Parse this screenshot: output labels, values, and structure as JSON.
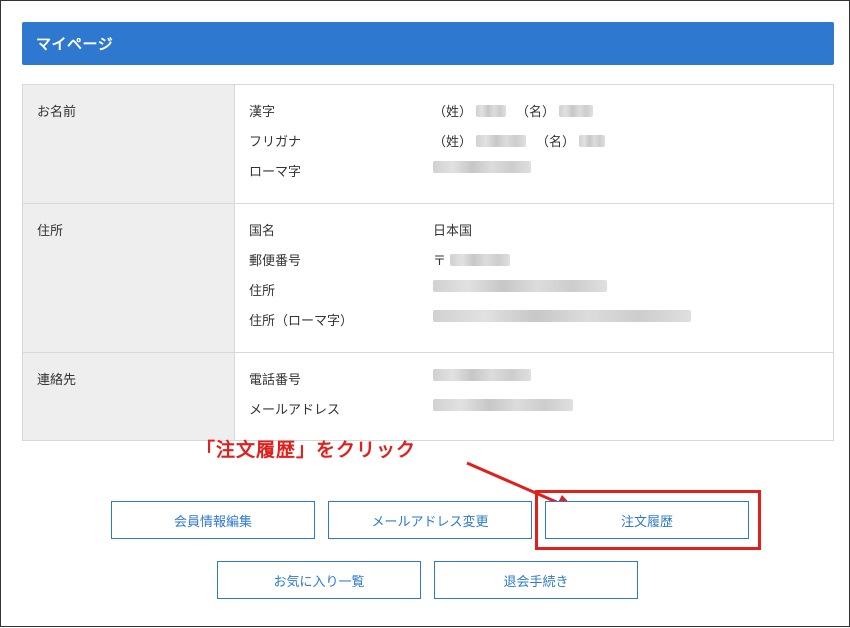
{
  "header": {
    "title": "マイページ"
  },
  "sections": {
    "name": {
      "label": "お名前",
      "fields": {
        "kanji": {
          "label": "漢字",
          "sei": "（姓）",
          "mei": "（名）"
        },
        "furigana": {
          "label": "フリガナ",
          "sei": "（姓）",
          "mei": "（名）"
        },
        "romaji": {
          "label": "ローマ字"
        }
      }
    },
    "address": {
      "label": "住所",
      "fields": {
        "country": {
          "label": "国名",
          "value": "日本国"
        },
        "postal": {
          "label": "郵便番号",
          "prefix": "〒"
        },
        "address": {
          "label": "住所"
        },
        "address_romaji": {
          "label": "住所（ローマ字）"
        }
      }
    },
    "contact": {
      "label": "連絡先",
      "fields": {
        "phone": {
          "label": "電話番号"
        },
        "email": {
          "label": "メールアドレス"
        }
      }
    }
  },
  "annotation": {
    "text": "「注文履歴」をクリック",
    "color": "#e0201c"
  },
  "buttons": {
    "edit_member": "会員情報編集",
    "change_email": "メールアドレス変更",
    "order_history": "注文履歴",
    "favorites": "お気に入り一覧",
    "withdraw": "退会手続き"
  },
  "colors": {
    "accent": "#2e78d0",
    "highlight": "#e0201c"
  }
}
